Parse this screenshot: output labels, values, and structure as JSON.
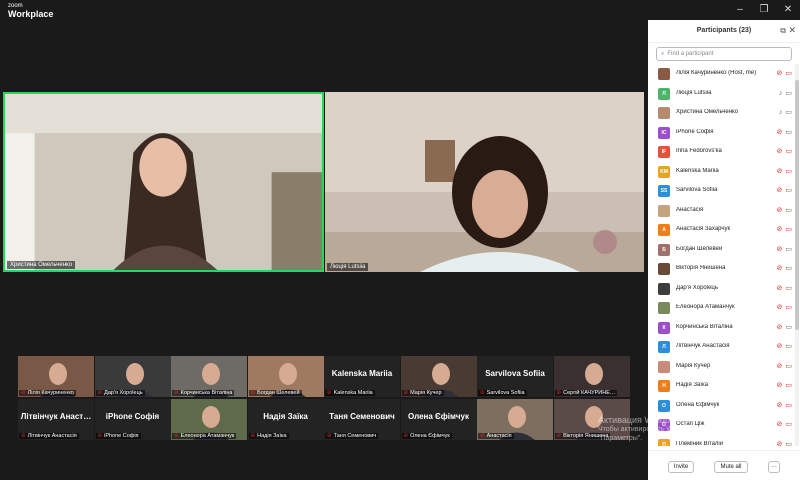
{
  "app": {
    "logo_line1": "zoom",
    "logo_line2": "Workplace"
  },
  "window_controls": {
    "minimize": "–",
    "maximize": "❐",
    "close": "✕"
  },
  "videos": [
    {
      "label": "Христина Омельченко"
    },
    {
      "label": "Люція Lutsiia"
    }
  ],
  "gallery": [
    {
      "label": "Лілія Качуриненко",
      "bigname": ""
    },
    {
      "label": "Дар'я Хорolець",
      "bigname": ""
    },
    {
      "label": "Корчинська Віталіна",
      "bigname": ""
    },
    {
      "label": "Богдан Шелевей",
      "bigname": ""
    },
    {
      "label": "Kalenska Mariia",
      "bigname": "Kalenska Mariia"
    },
    {
      "label": "Марія Кучер",
      "bigname": ""
    },
    {
      "label": "Sarvilova Sofiia",
      "bigname": "Sarvilova Sofiia"
    },
    {
      "label": "Сергій КАЧУРИНЕ…",
      "bigname": ""
    },
    {
      "label": "Літвінчук Анастасія",
      "bigname": "Літвінчук Анаст…"
    },
    {
      "label": "iPhone Софія",
      "bigname": "iPhone Софія"
    },
    {
      "label": "Елеонора Атаманчук",
      "bigname": ""
    },
    {
      "label": "Надія Заїка",
      "bigname": "Надія Заїка"
    },
    {
      "label": "Таня Семенович",
      "bigname": "Таня Семенович"
    },
    {
      "label": "Олена Єфімчук",
      "bigname": "Олена Єфімчук"
    },
    {
      "label": "Анастасія",
      "bigname": ""
    },
    {
      "label": "Вікторія Янишена",
      "bigname": ""
    }
  ],
  "panel": {
    "title": "Participants (23)",
    "search_placeholder": "Find a participant",
    "participants": [
      {
        "name": "Лілія Качуриненко (Host, me)",
        "avatar": "",
        "color": "#8a5a44",
        "mic": "muted",
        "cam": "off"
      },
      {
        "name": "Люція Lutsiia",
        "avatar": "Л",
        "color": "#4fb36a",
        "mic": "on",
        "cam": "on"
      },
      {
        "name": "Христина Омельченко",
        "avatar": "",
        "color": "#b58a70",
        "mic": "on",
        "cam": "on"
      },
      {
        "name": "iPhone Софія",
        "avatar": "IC",
        "color": "#9b4fc9",
        "mic": "muted",
        "cam": "off"
      },
      {
        "name": "Irina Fedorovs'ka",
        "avatar": "IF",
        "color": "#e0543a",
        "mic": "muted",
        "cam": "off"
      },
      {
        "name": "Kalenska Mariia",
        "avatar": "KM",
        "color": "#e8a323",
        "mic": "muted",
        "cam": "off"
      },
      {
        "name": "Sarvilova Sofiia",
        "avatar": "SS",
        "color": "#2e8fd8",
        "mic": "muted",
        "cam": "off"
      },
      {
        "name": "Анастасія",
        "avatar": "",
        "color": "#c7a27e",
        "mic": "muted",
        "cam": "off"
      },
      {
        "name": "Анастасія Захарчук",
        "avatar": "А",
        "color": "#ef7d1a",
        "mic": "muted",
        "cam": "off"
      },
      {
        "name": "Богдан Шелевей",
        "avatar": "Б",
        "color": "#a0716a",
        "mic": "muted",
        "cam": "on"
      },
      {
        "name": "Вікторія Янишена",
        "avatar": "",
        "color": "#6b4a3a",
        "mic": "muted",
        "cam": "off"
      },
      {
        "name": "Дар'я Хорolець",
        "avatar": "",
        "color": "#3d3d3d",
        "mic": "muted",
        "cam": "off"
      },
      {
        "name": "Елеонора Атаманчук",
        "avatar": "",
        "color": "#7a8a5a",
        "mic": "muted",
        "cam": "off"
      },
      {
        "name": "Корчинська Віталіна",
        "avatar": "К",
        "color": "#9b4fc9",
        "mic": "muted",
        "cam": "on"
      },
      {
        "name": "Літвінчук Анастасія",
        "avatar": "Л",
        "color": "#2e8fd8",
        "mic": "muted",
        "cam": "off"
      },
      {
        "name": "Марія Кучер",
        "avatar": "",
        "color": "#c98a7a",
        "mic": "muted",
        "cam": "off"
      },
      {
        "name": "Надія Заїка",
        "avatar": "Н",
        "color": "#ef7d1a",
        "mic": "muted",
        "cam": "off"
      },
      {
        "name": "Олена Єфімчук",
        "avatar": "О",
        "color": "#2e8fd8",
        "mic": "muted",
        "cam": "off"
      },
      {
        "name": "Остап Ціж",
        "avatar": "О",
        "color": "#9b4fc9",
        "mic": "muted",
        "cam": "off"
      },
      {
        "name": "Племіник Віталій",
        "avatar": "П",
        "color": "#e8a323",
        "mic": "muted",
        "cam": "off"
      }
    ],
    "invite_label": "Invite",
    "mute_all_label": "Mute all",
    "more_label": "···"
  },
  "watermark": {
    "line1": "Активация Windows",
    "line2": "Чтобы активировать Windows, перейдите в раздел",
    "line3": "\"Параметры\"."
  }
}
